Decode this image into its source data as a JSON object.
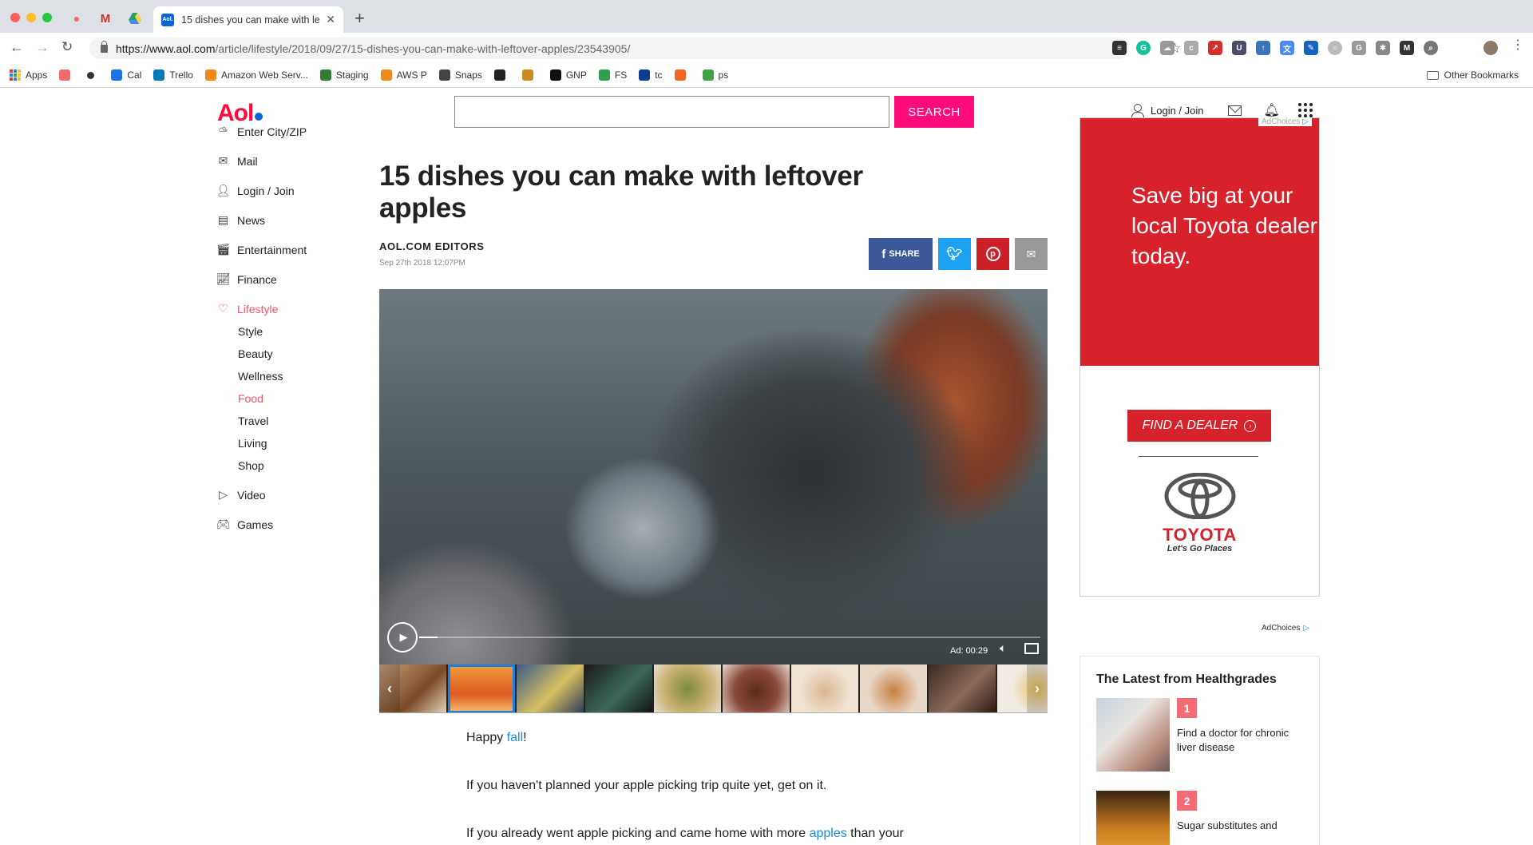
{
  "browser": {
    "active_tab_title": "15 dishes you can make with le",
    "url_domain": "https://www.aol.com",
    "url_path": "/article/lifestyle/2018/09/27/15-dishes-you-can-make-with-leftover-apples/23543905/",
    "bookmarks": [
      {
        "label": "Apps",
        "icon": "apps-grid-icon",
        "color": "#e53935"
      },
      {
        "label": "",
        "icon": "asana-icon",
        "color": "#f06a6a"
      },
      {
        "label": "",
        "icon": "dot-icon",
        "color": "#333333"
      },
      {
        "label": "Cal",
        "icon": "calendar-icon",
        "color": "#1a73e8"
      },
      {
        "label": "Trello",
        "icon": "trello-icon",
        "color": "#0079bf"
      },
      {
        "label": "Amazon Web Serv...",
        "icon": "aws-icon",
        "color": "#f08a1c"
      },
      {
        "label": "Staging",
        "icon": "staging-icon",
        "color": "#2e7d32"
      },
      {
        "label": "AWS P",
        "icon": "aws-icon",
        "color": "#f08a1c"
      },
      {
        "label": "Snaps",
        "icon": "snaps-icon",
        "color": "#444444"
      },
      {
        "label": "",
        "icon": "chat-icon",
        "color": "#222222"
      },
      {
        "label": "",
        "icon": "bot-icon",
        "color": "#c88b1e"
      },
      {
        "label": "GNP",
        "icon": "gnp-icon",
        "color": "#111111"
      },
      {
        "label": "FS",
        "icon": "fs-icon",
        "color": "#2e9e4f"
      },
      {
        "label": "tc",
        "icon": "tc-icon",
        "color": "#0b3d91"
      },
      {
        "label": "",
        "icon": "orange-icon",
        "color": "#f26522"
      },
      {
        "label": "ps",
        "icon": "ps-icon",
        "color": "#43a047"
      }
    ],
    "other_bookmarks": "Other Bookmarks"
  },
  "header": {
    "search_value": "",
    "search_button": "SEARCH",
    "login": "Login / Join"
  },
  "nav": {
    "items": [
      {
        "label": "Enter City/ZIP",
        "icon": "weather-icon"
      },
      {
        "label": "Mail",
        "icon": "mail-icon"
      },
      {
        "label": "Login / Join",
        "icon": "user-icon"
      },
      {
        "label": "News",
        "icon": "news-icon"
      },
      {
        "label": "Entertainment",
        "icon": "clapper-icon"
      },
      {
        "label": "Finance",
        "icon": "chart-icon"
      },
      {
        "label": "Lifestyle",
        "icon": "heart-icon"
      }
    ],
    "lifestyle_sub": [
      "Style",
      "Beauty",
      "Wellness",
      "Food",
      "Travel",
      "Living",
      "Shop"
    ],
    "bottom_items": [
      {
        "label": "Video",
        "icon": "play-icon"
      },
      {
        "label": "Games",
        "icon": "gamepad-icon"
      }
    ]
  },
  "article": {
    "title": "15 dishes you can make with leftover apples",
    "author": "AOL.COM EDITORS",
    "date": "Sep 27th 2018 12:07PM",
    "share_label": "SHARE",
    "video": {
      "ad_time": "Ad: 00:29",
      "progress": 0.03
    },
    "para1_prefix": "Happy ",
    "para1_link": "fall",
    "para1_suffix": "!",
    "para2": "If you haven't planned your apple picking trip quite yet, get on it.",
    "para3_prefix": "If you already went apple picking and came home with more ",
    "para3_link": "apples",
    "para3_suffix": " than your"
  },
  "ad": {
    "adchoices": "AdChoices",
    "headline": "Save big at your local Toyota dealer today.",
    "cta": "FIND A DEALER",
    "brand": "TOYOTA",
    "tagline": "Let's Go Places"
  },
  "latest": {
    "title": "The Latest from Healthgrades",
    "items": [
      {
        "num": "1",
        "text": "Find a doctor for chronic liver disease"
      },
      {
        "num": "2",
        "text": "Sugar substitutes and"
      }
    ]
  }
}
